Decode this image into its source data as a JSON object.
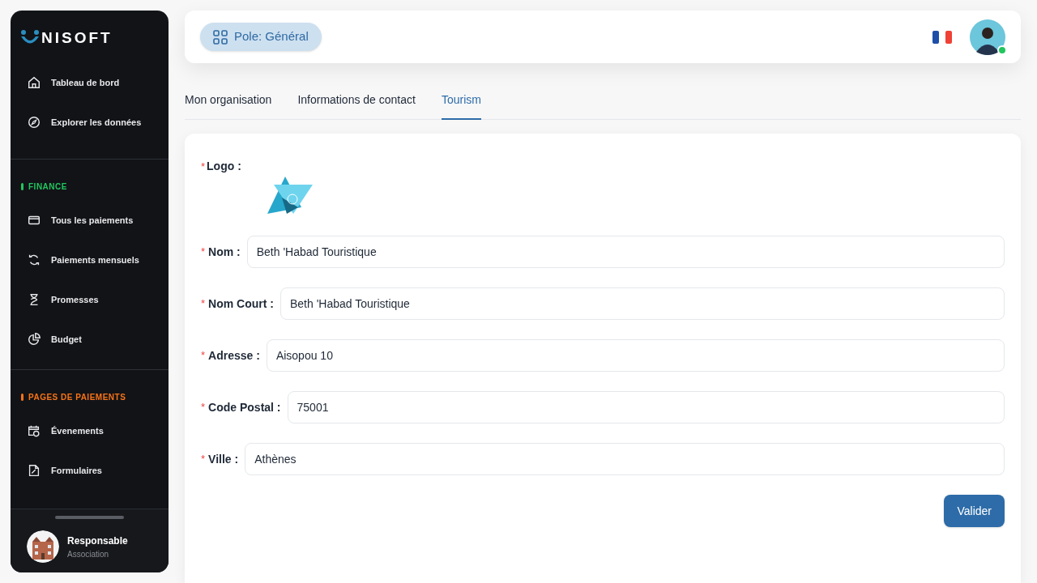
{
  "sidebar": {
    "brand": "NISOFT",
    "groups": [
      {
        "items": [
          {
            "label": "Tableau de bord",
            "selected": false
          },
          {
            "label": "Explorer les données",
            "selected": false
          }
        ]
      },
      {
        "title": "FINANCE",
        "color": "#22c55e",
        "items": [
          {
            "label": "Tous les paiements",
            "selected": false
          },
          {
            "label": "Paiements mensuels",
            "selected": false
          },
          {
            "label": "Promesses",
            "selected": false
          },
          {
            "label": "Budget",
            "selected": false
          }
        ]
      },
      {
        "title": "PAGES DE PAIEMENTS",
        "color": "#f97316",
        "items": [
          {
            "label": "Évenements",
            "selected": false
          },
          {
            "label": "Formulaires",
            "selected": false
          }
        ]
      }
    ],
    "user": {
      "name": "Responsable",
      "role": "Association"
    }
  },
  "header": {
    "pole": "Pole: Général",
    "user_online": true
  },
  "tabs": [
    {
      "label": "Mon organisation",
      "selected": false
    },
    {
      "label": "Informations de contact",
      "selected": false
    },
    {
      "label": "Tourism",
      "selected": true
    }
  ],
  "form": {
    "logo_mark": "*",
    "logo_label": "Logo :",
    "fields": [
      {
        "mark": "*",
        "label": "Nom :",
        "value": "Beth 'Habad Touristique"
      },
      {
        "mark": "*",
        "label": "Nom Court :",
        "value": "Beth 'Habad Touristique"
      },
      {
        "mark": "*",
        "label": "Adresse :",
        "value": "Aisopou 10"
      },
      {
        "mark": "*",
        "label": "Code Postal :",
        "value": "75001"
      },
      {
        "mark": "*",
        "label": "Ville :",
        "value": "Athènes"
      }
    ],
    "submit": "Valider"
  }
}
